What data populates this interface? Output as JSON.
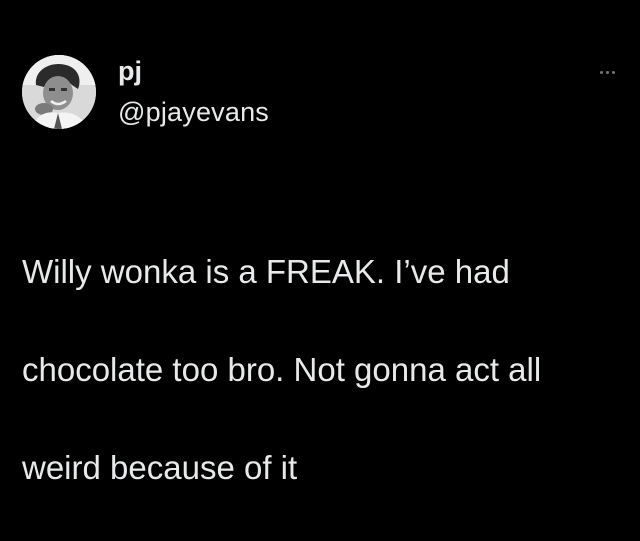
{
  "tweet": {
    "author": {
      "display_name": "pj",
      "handle": "@pjayevans",
      "avatar_icon": "profile-photo-icon"
    },
    "more_icon": "more-options-icon",
    "text_lines": [
      "Willy wonka is a FREAK. I’ve had",
      "chocolate too bro. Not gonna act all",
      "weird because of it"
    ],
    "colors": {
      "background": "#000000",
      "text": "#e7e9ea",
      "muted": "#71767b"
    }
  }
}
